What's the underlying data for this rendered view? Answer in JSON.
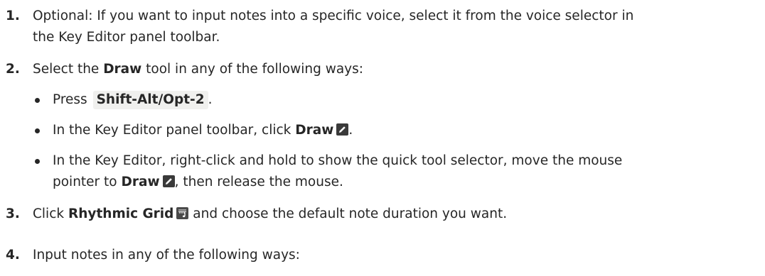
{
  "steps": [
    {
      "number": "1.",
      "line1": "Optional: If you want to input notes into a specific voice, select it from the voice selector in",
      "line2": "the Key Editor panel toolbar."
    },
    {
      "number": "2.",
      "pre": "Select the ",
      "bold": "Draw",
      "post": " tool in any of the following ways:",
      "bullets": [
        {
          "pre": "Press ",
          "shortcut": "Shift-Alt/Opt-2",
          "post": "."
        },
        {
          "pre": "In the Key Editor panel toolbar, click ",
          "bold": "Draw",
          "post": "."
        },
        {
          "line1": "In the Key Editor, right-click and hold to show the quick tool selector, move the mouse",
          "pre2": "pointer to ",
          "bold": "Draw",
          "post2": ", then release the mouse."
        }
      ]
    },
    {
      "number": "3.",
      "pre": "Click ",
      "bold": "Rhythmic Grid",
      "post": " and choose the default note duration you want."
    },
    {
      "number": "4.",
      "text": "Input notes in any of the following ways:"
    }
  ],
  "icons": {
    "draw": "draw-pencil-icon",
    "rhythmic_grid": "rhythmic-grid-icon"
  },
  "colors": {
    "text": "#262626",
    "shortcut_bg": "#f0f0ee",
    "icon_bg": "#3a3a3a"
  }
}
